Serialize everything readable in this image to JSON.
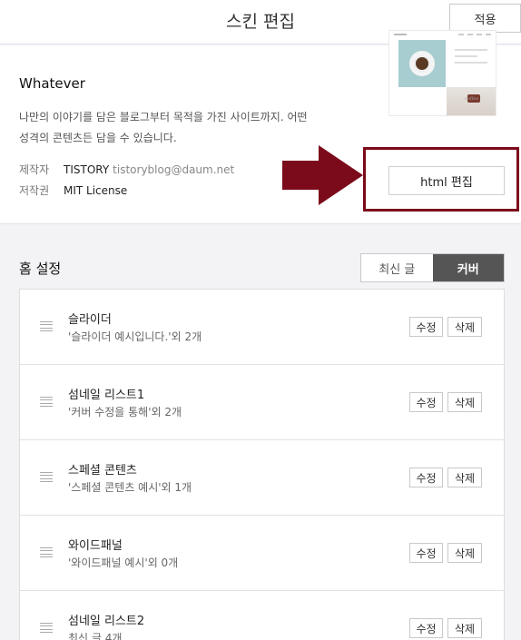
{
  "header": {
    "title": "스킨 편집",
    "apply_label": "적용"
  },
  "skin": {
    "name": "Whatever",
    "description": "나만의 이야기를 담은 블로그부터 목적을 가진 사이트까지. 어떤 성격의 콘텐츠든 담을 수 있습니다.",
    "maker_label": "제작자",
    "maker_name": "TISTORY",
    "maker_email": "tistoryblog@daum.net",
    "copyright_label": "저작권",
    "copyright_value": "MIT License",
    "html_edit_label": "html 편집",
    "thumb_text": "coffee"
  },
  "highlight": {
    "color": "#7b0a1b"
  },
  "home": {
    "title": "홈 설정",
    "segments": [
      {
        "label": "최신 글",
        "active": false
      },
      {
        "label": "커버",
        "active": true
      }
    ],
    "edit_label": "수정",
    "delete_label": "삭제",
    "items": [
      {
        "title": "슬라이더",
        "subtitle": "'슬라이더 예시입니다.'외 2개"
      },
      {
        "title": "섬네일 리스트1",
        "subtitle": "'커버 수정을 통해'외 2개"
      },
      {
        "title": "스페셜 콘텐츠",
        "subtitle": "'스페셜 콘텐츠 예시'외 1개"
      },
      {
        "title": "와이드패널",
        "subtitle": "'와이드패널 예시'외 0개"
      },
      {
        "title": "섬네일 리스트2",
        "subtitle": "최신 글 4개"
      }
    ]
  }
}
